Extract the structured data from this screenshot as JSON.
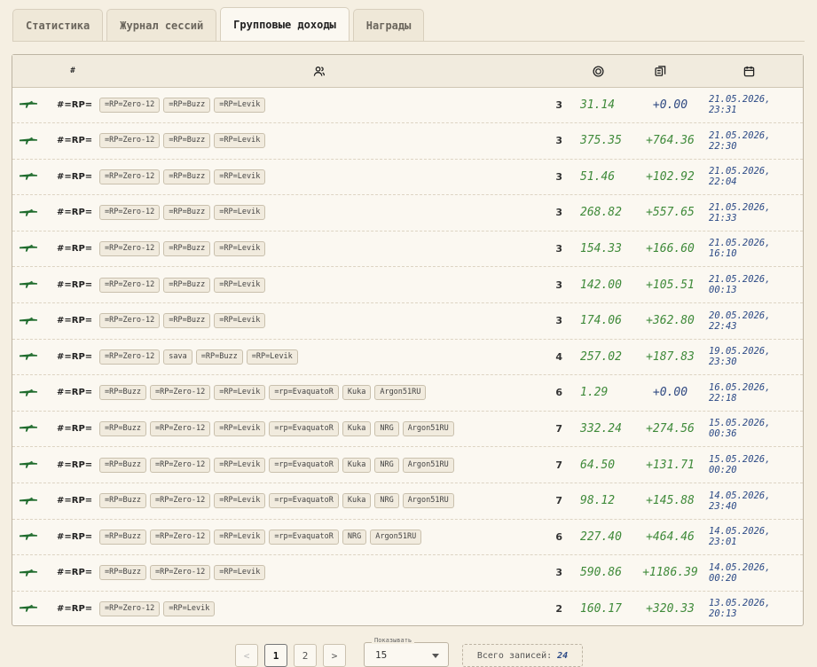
{
  "tabs": [
    "Статистика",
    "Журнал сессий",
    "Групповые доходы",
    "Награды"
  ],
  "active_tab": 2,
  "table": {
    "header_hash": "#",
    "icons": {
      "players": "players-icon",
      "rp": "rp-coin-icon",
      "money": "money-icon",
      "date": "calendar-icon",
      "row": "gun-icon"
    },
    "rows": [
      {
        "tag": "#=RP=",
        "players": [
          "=RP=Zero-12",
          "=RP=Buzz",
          "=RP=Levik"
        ],
        "count": "3",
        "rp": "31.14",
        "money": "+0.00",
        "date": "21.05.2026, 23:31"
      },
      {
        "tag": "#=RP=",
        "players": [
          "=RP=Zero-12",
          "=RP=Buzz",
          "=RP=Levik"
        ],
        "count": "3",
        "rp": "375.35",
        "money": "+764.36",
        "date": "21.05.2026, 22:30"
      },
      {
        "tag": "#=RP=",
        "players": [
          "=RP=Zero-12",
          "=RP=Buzz",
          "=RP=Levik"
        ],
        "count": "3",
        "rp": "51.46",
        "money": "+102.92",
        "date": "21.05.2026, 22:04"
      },
      {
        "tag": "#=RP=",
        "players": [
          "=RP=Zero-12",
          "=RP=Buzz",
          "=RP=Levik"
        ],
        "count": "3",
        "rp": "268.82",
        "money": "+557.65",
        "date": "21.05.2026, 21:33"
      },
      {
        "tag": "#=RP=",
        "players": [
          "=RP=Zero-12",
          "=RP=Buzz",
          "=RP=Levik"
        ],
        "count": "3",
        "rp": "154.33",
        "money": "+166.60",
        "date": "21.05.2026, 16:10"
      },
      {
        "tag": "#=RP=",
        "players": [
          "=RP=Zero-12",
          "=RP=Buzz",
          "=RP=Levik"
        ],
        "count": "3",
        "rp": "142.00",
        "money": "+105.51",
        "date": "21.05.2026, 00:13"
      },
      {
        "tag": "#=RP=",
        "players": [
          "=RP=Zero-12",
          "=RP=Buzz",
          "=RP=Levik"
        ],
        "count": "3",
        "rp": "174.06",
        "money": "+362.80",
        "date": "20.05.2026, 22:43"
      },
      {
        "tag": "#=RP=",
        "players": [
          "=RP=Zero-12",
          "sava",
          "=RP=Buzz",
          "=RP=Levik"
        ],
        "count": "4",
        "rp": "257.02",
        "money": "+187.83",
        "date": "19.05.2026, 23:30"
      },
      {
        "tag": "#=RP=",
        "players": [
          "=RP=Buzz",
          "=RP=Zero-12",
          "=RP=Levik",
          "=rp=EvaquatoR",
          "Kuka",
          "Argon51RU"
        ],
        "count": "6",
        "rp": "1.29",
        "money": "+0.00",
        "date": "16.05.2026, 22:18"
      },
      {
        "tag": "#=RP=",
        "players": [
          "=RP=Buzz",
          "=RP=Zero-12",
          "=RP=Levik",
          "=rp=EvaquatoR",
          "Kuka",
          "NRG",
          "Argon51RU"
        ],
        "count": "7",
        "rp": "332.24",
        "money": "+274.56",
        "date": "15.05.2026, 00:36"
      },
      {
        "tag": "#=RP=",
        "players": [
          "=RP=Buzz",
          "=RP=Zero-12",
          "=RP=Levik",
          "=rp=EvaquatoR",
          "Kuka",
          "NRG",
          "Argon51RU"
        ],
        "count": "7",
        "rp": "64.50",
        "money": "+131.71",
        "date": "15.05.2026, 00:20"
      },
      {
        "tag": "#=RP=",
        "players": [
          "=RP=Buzz",
          "=RP=Zero-12",
          "=RP=Levik",
          "=rp=EvaquatoR",
          "Kuka",
          "NRG",
          "Argon51RU"
        ],
        "count": "7",
        "rp": "98.12",
        "money": "+145.88",
        "date": "14.05.2026, 23:40"
      },
      {
        "tag": "#=RP=",
        "players": [
          "=RP=Buzz",
          "=RP=Zero-12",
          "=RP=Levik",
          "=rp=EvaquatoR",
          "NRG",
          "Argon51RU"
        ],
        "count": "6",
        "rp": "227.40",
        "money": "+464.46",
        "date": "14.05.2026, 23:01"
      },
      {
        "tag": "#=RP=",
        "players": [
          "=RP=Buzz",
          "=RP=Zero-12",
          "=RP=Levik"
        ],
        "count": "3",
        "rp": "590.86",
        "money": "+1186.39",
        "date": "14.05.2026, 00:20"
      },
      {
        "tag": "#=RP=",
        "players": [
          "=RP=Zero-12",
          "=RP=Levik"
        ],
        "count": "2",
        "rp": "160.17",
        "money": "+320.33",
        "date": "13.05.2026, 20:13"
      }
    ]
  },
  "pagination": {
    "prev": "<",
    "pages": [
      "1",
      "2"
    ],
    "current": "1",
    "next": ">",
    "per_page_label": "Показывать",
    "per_page_value": "15",
    "total_label": "Всего записей:",
    "total_value": "24"
  },
  "colors": {
    "background": "#f5efe2",
    "rp_green": "#3f8a3a",
    "date_blue": "#2c4a86",
    "icon_green": "#1e6b2c"
  }
}
